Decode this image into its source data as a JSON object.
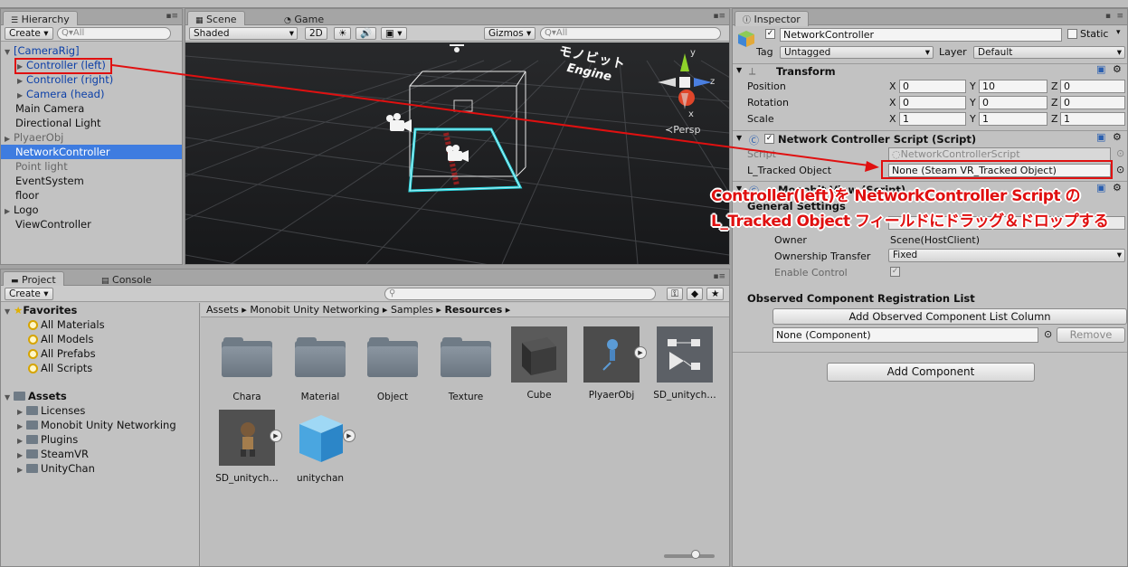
{
  "hierarchy": {
    "tab": "Hierarchy",
    "create": "Create",
    "search_placeholder": "Q▾All",
    "items": [
      {
        "label": "[CameraRig]"
      },
      {
        "label": "Controller (left)"
      },
      {
        "label": "Controller (right)"
      },
      {
        "label": "Camera (head)"
      },
      {
        "label": "Main Camera"
      },
      {
        "label": "Directional Light"
      },
      {
        "label": "PlyaerObj"
      },
      {
        "label": "NetworkController"
      },
      {
        "label": "Point light"
      },
      {
        "label": "EventSystem"
      },
      {
        "label": "floor"
      },
      {
        "label": "Logo"
      },
      {
        "label": "ViewController"
      }
    ]
  },
  "scene": {
    "tab_scene": "Scene",
    "tab_game": "Game",
    "shading": "Shaded",
    "mode_2d": "2D",
    "gizmos": "Gizmos",
    "search_placeholder": "Q▾All",
    "persp": "Persp",
    "logo_line1": "モノビット",
    "logo_line2": "Engine",
    "axis_y": "y",
    "axis_z": "z",
    "axis_x": "x"
  },
  "annotation": {
    "line1": "Controller(left)を NetworkController Script の",
    "line2": "L_Tracked Object フィールドにドラッグ＆ドロップする",
    "color": "#e01010"
  },
  "project": {
    "tab_project": "Project",
    "tab_console": "Console",
    "create": "Create",
    "favorites": {
      "title": "Favorites",
      "items": [
        "All Materials",
        "All Models",
        "All Prefabs",
        "All Scripts"
      ]
    },
    "assets_tree": {
      "title": "Assets",
      "items": [
        "Licenses",
        "Monobit Unity Networking",
        "Plugins",
        "SteamVR",
        "UnityChan"
      ]
    },
    "breadcrumb": [
      "Assets",
      "Monobit Unity Networking",
      "Samples",
      "Resources"
    ],
    "assets": [
      "Chara",
      "Material",
      "Object",
      "Texture",
      "Cube",
      "PlyaerObj",
      "SD_unitych…",
      "SD_unitych…",
      "unitychan"
    ]
  },
  "inspector": {
    "tab": "Inspector",
    "object_name": "NetworkController",
    "static_label": "Static",
    "tag_label": "Tag",
    "tag_value": "Untagged",
    "layer_label": "Layer",
    "layer_value": "Default",
    "transform": {
      "title": "Transform",
      "rows": [
        {
          "label": "Position",
          "x": "0",
          "y": "10",
          "z": "0"
        },
        {
          "label": "Rotation",
          "x": "0",
          "y": "0",
          "z": "0"
        },
        {
          "label": "Scale",
          "x": "1",
          "y": "1",
          "z": "1"
        }
      ],
      "x_label": "X",
      "y_label": "Y",
      "z_label": "Z"
    },
    "script_component": {
      "title": "Network Controller Script (Script)",
      "script_label": "Script",
      "script_value": "NetworkControllerScript",
      "tracked_label": "L_Tracked Object",
      "tracked_value": "None (Steam VR_Tracked Object)"
    },
    "monobit_view": {
      "title": "Monobit View (Script)",
      "general": "General Settings",
      "owner_label": "Owner",
      "owner_value": "Scene(HostClient)",
      "transfer_label": "Ownership Transfer",
      "transfer_value": "Fixed",
      "enable_label": "Enable Control",
      "observed_title": "Observed Component Registration List",
      "add_observed": "Add Observed Component List Column",
      "none_component": "None (Component)",
      "remove": "Remove"
    },
    "add_component": "Add Component"
  }
}
